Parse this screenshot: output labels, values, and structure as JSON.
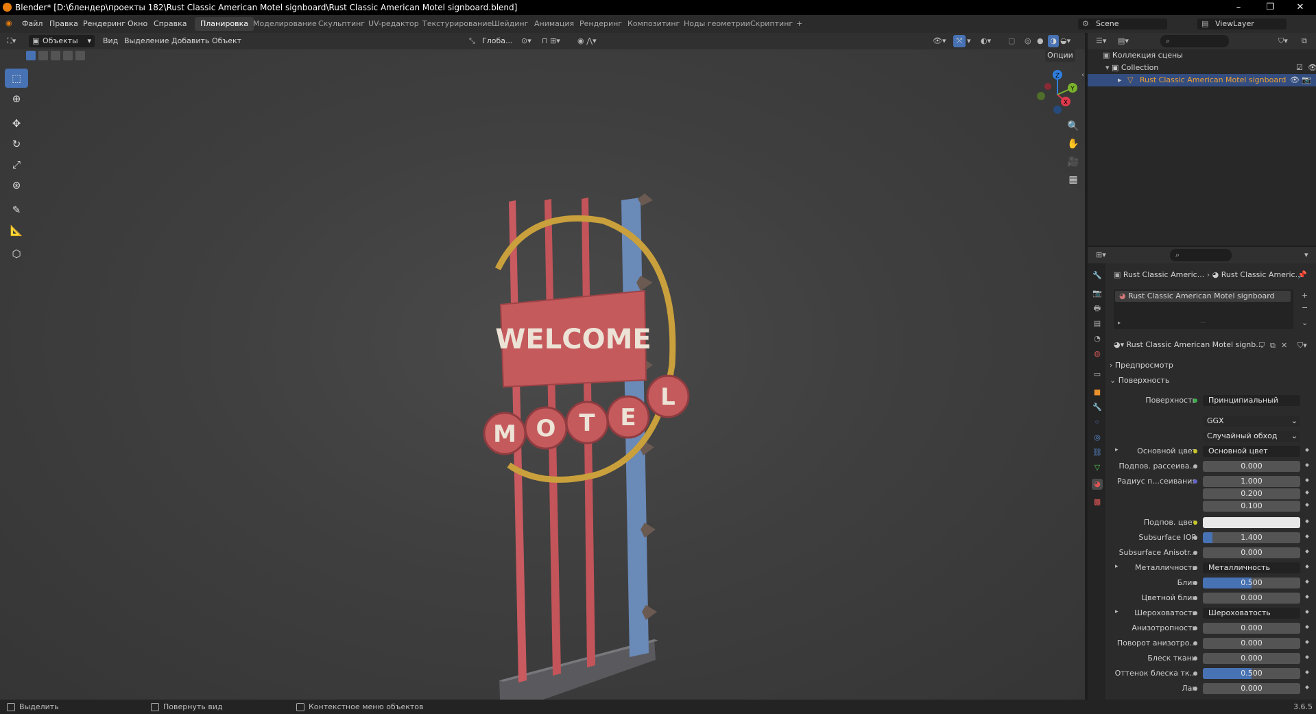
{
  "window": {
    "title": "Blender* [D:\\блендер\\проекты 182\\Rust Classic American Motel signboard\\Rust Classic American Motel signboard.blend]"
  },
  "menu": {
    "items": [
      "Файл",
      "Правка",
      "Рендеринг",
      "Окно",
      "Справка"
    ],
    "workspaces": [
      "Планировка",
      "Моделирование",
      "Скульптинг",
      "UV-редактор",
      "Текстурирование",
      "Шейдинг",
      "Анимация",
      "Рендеринг",
      "Композитинг",
      "Ноды геометрии",
      "Скриптинг"
    ],
    "active_workspace": "Планировка",
    "add_tab": "+",
    "scene": "Scene",
    "view_layer": "ViewLayer"
  },
  "viewport_header": {
    "mode": "Объекты",
    "menus": [
      "Вид",
      "Выделение",
      "Добавить",
      "Объект"
    ],
    "orientation": "Глоба...",
    "options": "Опции"
  },
  "gizmo": {
    "z": "Z",
    "y": "Y",
    "x": "X"
  },
  "sign": {
    "welcome": "WELCOME",
    "motel": [
      "M",
      "O",
      "T",
      "E",
      "L"
    ]
  },
  "outliner": {
    "scene_collection": "Коллекция сцены",
    "collection": "Collection",
    "object": "Rust Classic American Motel signboard"
  },
  "properties": {
    "breadcrumb_object": "Rust Classic Americ...",
    "breadcrumb_material": "Rust Classic Americ...",
    "slot_name": "Rust Classic American Motel signboard",
    "material_name": "Rust Classic American Motel signb...",
    "section_preview": "Предпросмотр",
    "section_surface": "Поверхность",
    "surface_label": "Поверхность",
    "surface_value": "Принципиальный BSDF",
    "distribution": "GGX",
    "subsurface_method": "Случайный обход",
    "rows": [
      {
        "label": "Основной цвет",
        "type": "link",
        "value": "Основной цвет",
        "dot": "y",
        "arrow": true
      },
      {
        "label": "Подпов. рассеива...",
        "type": "num",
        "value": "0.000",
        "fill": 0
      },
      {
        "label": "Радиус п...сеивания",
        "type": "num",
        "value": "1.000",
        "fill": 0,
        "dot": "v"
      },
      {
        "label": "",
        "type": "num",
        "value": "0.200",
        "fill": 0,
        "nodot": true
      },
      {
        "label": "",
        "type": "num",
        "value": "0.100",
        "fill": 0,
        "nodot": true
      },
      {
        "label": "Подпов. цвет",
        "type": "color",
        "value": "",
        "dot": "y",
        "color": "#e8e8e8"
      },
      {
        "label": "Subsurface IOR",
        "type": "num",
        "value": "1.400",
        "fill": 0.1
      },
      {
        "label": "Subsurface Anisotr...",
        "type": "num",
        "value": "0.000",
        "fill": 0
      },
      {
        "label": "Металличность",
        "type": "link",
        "value": "Металличность",
        "arrow": true
      },
      {
        "label": "Блик",
        "type": "num",
        "value": "0.500",
        "fill": 0.5
      },
      {
        "label": "Цветной блик",
        "type": "num",
        "value": "0.000",
        "fill": 0
      },
      {
        "label": "Шероховатость",
        "type": "link",
        "value": "Шероховатость",
        "arrow": true
      },
      {
        "label": "Анизотропность",
        "type": "num",
        "value": "0.000",
        "fill": 0
      },
      {
        "label": "Поворот анизотро...",
        "type": "num",
        "value": "0.000",
        "fill": 0
      },
      {
        "label": "Блеск ткани",
        "type": "num",
        "value": "0.000",
        "fill": 0
      },
      {
        "label": "Оттенок блеска тк...",
        "type": "num",
        "value": "0.500",
        "fill": 0.5
      },
      {
        "label": "Лак",
        "type": "num",
        "value": "0.000",
        "fill": 0
      }
    ]
  },
  "status": {
    "select": "Выделить",
    "rotate": "Повернуть вид",
    "context": "Контекстное меню объектов",
    "version": "3.6.5"
  },
  "colors": {
    "accent": "#4772b3",
    "selected_row": "#334d80",
    "object_text": "#f0a030"
  }
}
